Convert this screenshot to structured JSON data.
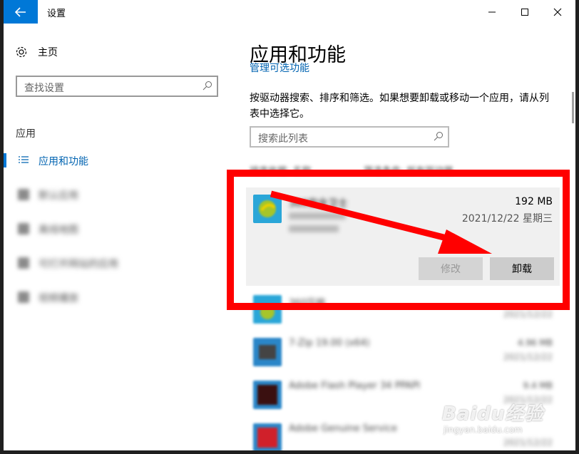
{
  "window": {
    "title": "设置"
  },
  "sidebar": {
    "home_label": "主页",
    "search_placeholder": "查找设置",
    "section_label": "应用",
    "items": [
      {
        "label": "应用和功能",
        "active": true
      },
      {
        "label": "默认应用",
        "active": false
      },
      {
        "label": "离线地图",
        "active": false
      },
      {
        "label": "可打开网站的应用",
        "active": false
      },
      {
        "label": "视频播放",
        "active": false
      }
    ]
  },
  "main": {
    "page_title": "应用和功能",
    "cut_link": "管理可选功能",
    "description": "按驱动器搜索、排序和筛选。如果想要卸载或移动一个应用，请从列表中选择它。",
    "list_search_placeholder": "搜索此列表",
    "sort_label": "排序依据: 名称",
    "filter_label": "筛选条件: 所有驱动器",
    "selected_app": {
      "name": "360安全卫士",
      "size": "192 MB",
      "date": "2021/12/22 星期三",
      "modify_label": "修改",
      "uninstall_label": "卸载"
    },
    "apps": [
      {
        "name": "360压缩",
        "size": "",
        "date": "2021/12/22"
      },
      {
        "name": "7-Zip 19.00 (x64)",
        "size": "4.96 MB",
        "date": "2021/12/22"
      },
      {
        "name": "Adobe Flash Player 34 PPAPI",
        "size": "9.4 MB",
        "date": "2021/12/22"
      },
      {
        "name": "Adobe Genuine Service",
        "size": "",
        "date": "2021/12/22"
      }
    ]
  },
  "watermark": {
    "brand": "Baidu经验",
    "url": "jingyan.baidu.com"
  },
  "colors": {
    "accent": "#0078d7",
    "annotation": "#ff0000"
  }
}
